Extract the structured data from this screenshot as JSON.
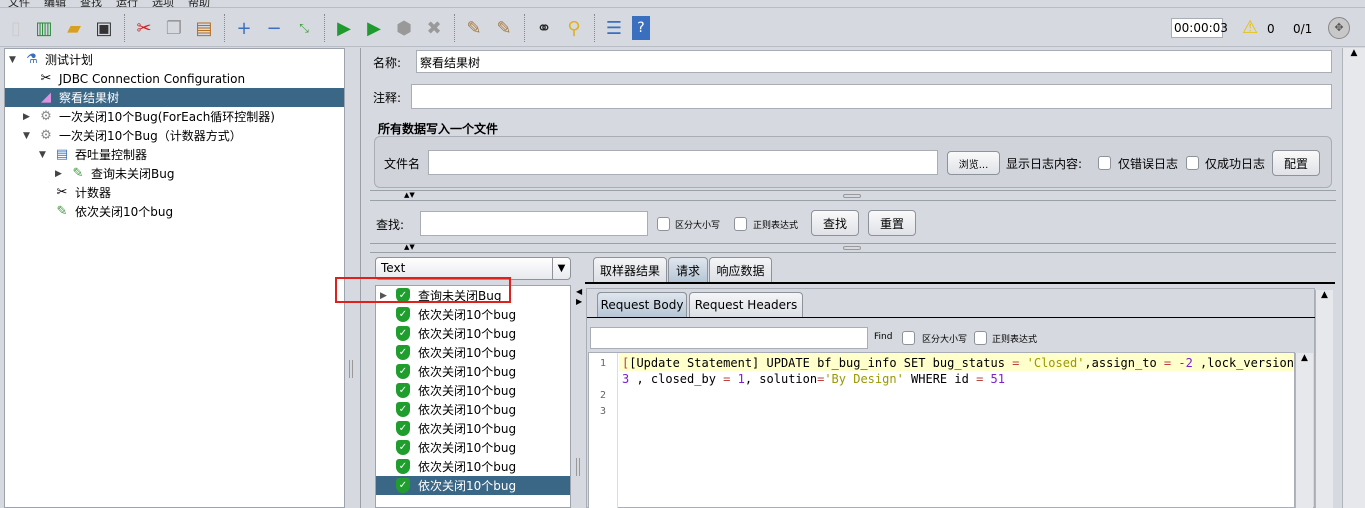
{
  "menu": [
    "文件",
    "编辑",
    "查找",
    "运行",
    "选项",
    "帮助"
  ],
  "toolbar": {
    "icons": [
      "new-icon",
      "templates-icon",
      "open-icon",
      "save-icon",
      "cut-icon",
      "copy-icon",
      "paste-icon",
      "expand-icon",
      "collapse-icon",
      "toggle-icon",
      "start-icon",
      "start-no-pause-icon",
      "stop-icon",
      "shutdown-icon",
      "clear-icon",
      "clear-all-icon",
      "search-icon",
      "reset-search-icon",
      "function-helper-icon",
      "help-icon"
    ],
    "timer": "00:00:03",
    "warnings": "0",
    "threads": "0/1"
  },
  "tree": [
    {
      "label": "测试计划",
      "icon": "test-plan-icon",
      "expanded": true
    },
    {
      "label": "JDBC Connection Configuration",
      "icon": "config-icon"
    },
    {
      "label": "察看结果树",
      "icon": "listener-icon",
      "selected": true
    },
    {
      "label": "一次关闭10个Bug(ForEach循环控制器)",
      "icon": "thread-group-icon",
      "expanded": false
    },
    {
      "label": "一次关闭10个Bug（计数器方式）",
      "icon": "thread-group-icon",
      "expanded": true
    },
    {
      "label": "吞吐量控制器",
      "icon": "controller-icon",
      "expanded": true
    },
    {
      "label": "查询未关闭Bug",
      "icon": "sampler-icon",
      "expanded": false
    },
    {
      "label": "计数器",
      "icon": "config-icon"
    },
    {
      "label": "依次关闭10个bug",
      "icon": "sampler-icon"
    }
  ],
  "form": {
    "name_label": "名称:",
    "name_value": "察看结果树",
    "comment_label": "注释:",
    "comment_value": "",
    "section_title": "所有数据写入一个文件",
    "file_label": "文件名",
    "file_value": "",
    "browse": "浏览...",
    "log_label": "显示日志内容:",
    "errors_only": "仅错误日志",
    "success_only": "仅成功日志",
    "configure": "配置"
  },
  "search": {
    "label": "查找:",
    "value": "",
    "case": "区分大小写",
    "regex": "正则表达式",
    "find": "查找",
    "reset": "重置"
  },
  "results": {
    "renderer": "Text",
    "items": [
      {
        "label": "查询未关闭Bug",
        "expandable": true
      },
      {
        "label": "依次关闭10个bug"
      },
      {
        "label": "依次关闭10个bug"
      },
      {
        "label": "依次关闭10个bug"
      },
      {
        "label": "依次关闭10个bug"
      },
      {
        "label": "依次关闭10个bug"
      },
      {
        "label": "依次关闭10个bug"
      },
      {
        "label": "依次关闭10个bug"
      },
      {
        "label": "依次关闭10个bug"
      },
      {
        "label": "依次关闭10个bug"
      },
      {
        "label": "依次关闭10个bug",
        "selected": true
      }
    ]
  },
  "tabs": [
    "取样器结果",
    "请求",
    "响应数据"
  ],
  "active_tab": "请求",
  "subtabs": [
    "Request Body",
    "Request Headers"
  ],
  "find_bar": {
    "label": "Find",
    "case": "区分大小写",
    "regex": "正则表达式",
    "value": ""
  },
  "editor": {
    "line_numbers": [
      "1",
      "2",
      "3"
    ],
    "line1a": "[Update Statement]",
    "line1b": " UPDATE bf_bug_info SET bug_status ",
    "eq": "=",
    "s1": " 'Closed'",
    "line1c": ",assign_to ",
    "n1": " -2",
    "line1d": " ,lock_version ",
    "l2n": "3",
    "l2a": " , closed_by ",
    "n2": " 1",
    "l2b": ", solution",
    "s2": "'By Design'",
    "l2c": " WHERE id ",
    "n3": " 51"
  },
  "colors": {
    "selection": "#3b6787",
    "highlight_box": "#e0201b",
    "string": "#999900",
    "number": "#7a1fd1",
    "operator": "#c04040",
    "current_line": "#ffffcc"
  }
}
